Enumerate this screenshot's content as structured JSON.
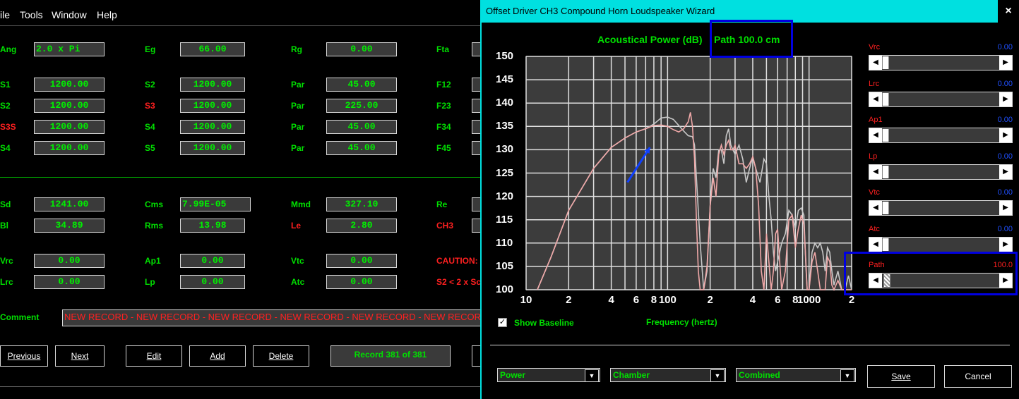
{
  "menu": [
    "ile",
    "Tools",
    "Window",
    "Help"
  ],
  "fields_row1": [
    {
      "label": "Ang",
      "value": "2.0 x Pi"
    },
    {
      "label": "Eg",
      "value": "66.00"
    },
    {
      "label": "Rg",
      "value": "0.00"
    },
    {
      "label": "Fta",
      "value": ""
    }
  ],
  "block_a": {
    "col1": [
      {
        "label": "S1",
        "value": "1200.00"
      },
      {
        "label": "S2",
        "value": "1200.00"
      },
      {
        "label": "S3S",
        "value": "1200.00"
      },
      {
        "label": "S4",
        "value": "1200.00"
      }
    ],
    "col2": [
      {
        "label": "S2",
        "value": "1200.00"
      },
      {
        "label": "S3",
        "value": "1200.00"
      },
      {
        "label": "S4",
        "value": "1200.00"
      },
      {
        "label": "S5",
        "value": "1200.00"
      }
    ],
    "col3": [
      {
        "label": "Par",
        "value": "45.00"
      },
      {
        "label": "Par",
        "value": "225.00"
      },
      {
        "label": "Par",
        "value": "45.00"
      },
      {
        "label": "Par",
        "value": "45.00"
      }
    ],
    "col4": [
      {
        "label": "F12"
      },
      {
        "label": "F23"
      },
      {
        "label": "F34"
      },
      {
        "label": "F45"
      }
    ]
  },
  "block_b": {
    "col1": [
      {
        "label": "Sd",
        "value": "1241.00"
      },
      {
        "label": "Bl",
        "value": "34.89"
      }
    ],
    "col2": [
      {
        "label": "Cms",
        "value": "7.99E-05"
      },
      {
        "label": "Rms",
        "value": "13.98"
      }
    ],
    "col3": [
      {
        "label": "Mmd",
        "value": "327.10"
      },
      {
        "label": "Le",
        "value": "2.80"
      }
    ],
    "col4": [
      {
        "label": "Re"
      },
      {
        "label": "CH3"
      }
    ]
  },
  "block_c": {
    "col1": [
      {
        "label": "Vrc",
        "value": "0.00"
      },
      {
        "label": "Lrc",
        "value": "0.00"
      }
    ],
    "col2": [
      {
        "label": "Ap1",
        "value": "0.00"
      },
      {
        "label": "Lp",
        "value": "0.00"
      }
    ],
    "col3": [
      {
        "label": "Vtc",
        "value": "0.00"
      },
      {
        "label": "Atc",
        "value": "0.00"
      }
    ],
    "col4": [
      {
        "label": "CAUTION:"
      },
      {
        "label": "S2 < 2 x Sc"
      }
    ]
  },
  "comment": {
    "label": "Comment",
    "value": "NEW RECORD - NEW RECORD - NEW RECORD - NEW RECORD - NEW RECORD - NEW RECORD"
  },
  "nav_buttons": [
    "Previous",
    "Next",
    "Edit",
    "Add",
    "Delete"
  ],
  "record_status": "Record 381 of 381",
  "dialog": {
    "title": "Offset Driver CH3 Compound Horn Loudspeaker Wizard",
    "close": "×",
    "show_baseline": "Show Baseline",
    "frequency_label": "Frequency (hertz)",
    "sliders": [
      {
        "label": "Vrc",
        "value": "0.00",
        "pos": 0
      },
      {
        "label": "Lrc",
        "value": "0.00",
        "pos": 0
      },
      {
        "label": "Ap1",
        "value": "0.00",
        "pos": 0
      },
      {
        "label": "Lp",
        "value": "0.00",
        "pos": 0
      },
      {
        "label": "Vtc",
        "value": "0.00",
        "pos": 0
      },
      {
        "label": "Atc",
        "value": "0.00",
        "pos": 0
      },
      {
        "label": "Path",
        "value": "100.0",
        "pos": 0.01
      }
    ],
    "combos": [
      "Power",
      "Chamber",
      "Combined"
    ],
    "save": "Save",
    "cancel": "Cancel"
  },
  "chart_data": {
    "type": "line",
    "title": "Acoustical Power (dB)",
    "subtitle": "Path 100.0 cm",
    "xlabel": "Frequency (hertz)",
    "xscale": "log",
    "xlim": [
      10,
      2000
    ],
    "ylim": [
      100,
      150
    ],
    "yticks": [
      100,
      105,
      110,
      115,
      120,
      125,
      130,
      135,
      140,
      145,
      150
    ],
    "xtick_labels": [
      {
        "v": 10,
        "t": "10"
      },
      {
        "v": 20,
        "t": "2"
      },
      {
        "v": 40,
        "t": "4"
      },
      {
        "v": 60,
        "t": "6"
      },
      {
        "v": 80,
        "t": "8"
      },
      {
        "v": 100,
        "t": "100"
      },
      {
        "v": 200,
        "t": "2"
      },
      {
        "v": 400,
        "t": "4"
      },
      {
        "v": 600,
        "t": "6"
      },
      {
        "v": 800,
        "t": "8"
      },
      {
        "v": 1000,
        "t": "1000"
      },
      {
        "v": 2000,
        "t": "2"
      }
    ],
    "grid": true,
    "series": [
      {
        "color": "#c8c8c8",
        "points": [
          [
            12,
            100
          ],
          [
            15,
            107
          ],
          [
            20,
            117
          ],
          [
            30,
            126
          ],
          [
            40,
            130.5
          ],
          [
            50,
            132.5
          ],
          [
            60,
            133.8
          ],
          [
            70,
            134.5
          ],
          [
            80,
            135.5
          ],
          [
            90,
            136.8
          ],
          [
            100,
            137
          ],
          [
            110,
            136.5
          ],
          [
            120,
            135.2
          ],
          [
            130,
            134
          ],
          [
            140,
            133
          ],
          [
            150,
            132.8
          ],
          [
            155,
            131
          ],
          [
            160,
            124
          ],
          [
            170,
            110
          ],
          [
            180,
            100
          ],
          [
            190,
            104
          ],
          [
            200,
            118
          ],
          [
            210,
            126
          ],
          [
            220,
            124
          ],
          [
            230,
            130
          ],
          [
            240,
            130
          ],
          [
            250,
            127
          ],
          [
            260,
            133
          ],
          [
            270,
            134.5
          ],
          [
            280,
            131
          ],
          [
            300,
            129
          ],
          [
            320,
            131
          ],
          [
            340,
            128
          ],
          [
            360,
            123
          ],
          [
            380,
            126
          ],
          [
            400,
            128.5
          ],
          [
            420,
            126
          ],
          [
            450,
            123
          ],
          [
            480,
            128
          ],
          [
            500,
            127
          ],
          [
            520,
            120
          ],
          [
            540,
            115
          ],
          [
            560,
            108
          ],
          [
            580,
            104
          ],
          [
            600,
            106
          ],
          [
            640,
            110
          ],
          [
            680,
            112
          ],
          [
            720,
            117
          ],
          [
            760,
            116
          ],
          [
            800,
            113
          ],
          [
            840,
            117
          ],
          [
            880,
            117.5
          ],
          [
            920,
            116
          ],
          [
            950,
            105
          ],
          [
            970,
            100
          ],
          [
            1000,
            100
          ],
          [
            1050,
            108
          ],
          [
            1100,
            110
          ],
          [
            1150,
            109
          ],
          [
            1200,
            110
          ],
          [
            1250,
            108
          ],
          [
            1300,
            104
          ],
          [
            1350,
            109
          ],
          [
            1400,
            108
          ],
          [
            1450,
            104
          ],
          [
            1500,
            101
          ],
          [
            1600,
            104
          ],
          [
            1700,
            100
          ],
          [
            1800,
            100
          ],
          [
            1900,
            103
          ],
          [
            2000,
            100
          ]
        ]
      },
      {
        "color": "#f0a8a8",
        "points": [
          [
            12,
            100
          ],
          [
            15,
            107
          ],
          [
            20,
            117
          ],
          [
            30,
            126
          ],
          [
            40,
            130.5
          ],
          [
            50,
            132.5
          ],
          [
            60,
            133.8
          ],
          [
            70,
            134.5
          ],
          [
            80,
            135.2
          ],
          [
            90,
            135.3
          ],
          [
            100,
            135
          ],
          [
            110,
            134.3
          ],
          [
            120,
            133.8
          ],
          [
            130,
            134.5
          ],
          [
            140,
            136
          ],
          [
            145,
            138
          ],
          [
            150,
            135
          ],
          [
            155,
            128
          ],
          [
            160,
            115
          ],
          [
            165,
            104
          ],
          [
            170,
            100
          ],
          [
            180,
            100
          ],
          [
            190,
            105
          ],
          [
            200,
            118
          ],
          [
            210,
            124
          ],
          [
            220,
            120
          ],
          [
            230,
            129
          ],
          [
            240,
            131
          ],
          [
            250,
            129
          ],
          [
            260,
            131
          ],
          [
            270,
            132
          ],
          [
            280,
            130
          ],
          [
            290,
            130
          ],
          [
            300,
            131
          ],
          [
            320,
            127
          ],
          [
            340,
            127
          ],
          [
            360,
            126
          ],
          [
            380,
            127
          ],
          [
            400,
            128.5
          ],
          [
            420,
            126
          ],
          [
            440,
            118
          ],
          [
            460,
            104
          ],
          [
            480,
            100
          ],
          [
            500,
            112
          ],
          [
            520,
            106
          ],
          [
            540,
            100
          ],
          [
            560,
            104
          ],
          [
            580,
            112
          ],
          [
            600,
            113
          ],
          [
            620,
            106
          ],
          [
            640,
            100
          ],
          [
            680,
            104
          ],
          [
            720,
            115
          ],
          [
            760,
            116
          ],
          [
            800,
            109
          ],
          [
            840,
            113
          ],
          [
            880,
            116
          ],
          [
            920,
            114
          ],
          [
            950,
            106
          ],
          [
            970,
            100
          ],
          [
            1000,
            100
          ],
          [
            1050,
            106
          ],
          [
            1100,
            108
          ],
          [
            1150,
            104
          ],
          [
            1200,
            100
          ],
          [
            1300,
            100
          ],
          [
            1350,
            107
          ],
          [
            1400,
            106
          ],
          [
            1450,
            101
          ],
          [
            1500,
            100
          ],
          [
            1600,
            102
          ],
          [
            1700,
            100
          ],
          [
            2000,
            100
          ]
        ]
      }
    ],
    "annotation_arrow": {
      "from": [
        52,
        123
      ],
      "to": [
        75,
        130.5
      ]
    }
  }
}
